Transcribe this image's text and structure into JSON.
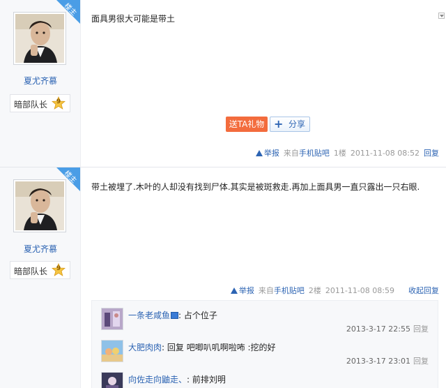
{
  "badge_label": "楼主",
  "posts": [
    {
      "author": "夏尤齐慕",
      "rank_name": "暗部队长",
      "rank_level": "9",
      "content": "面具男很大可能是带土",
      "gift_label": "送TA礼物",
      "share_label": "分享",
      "report_label": "举报",
      "source_prefix": "来自",
      "source_link": "手机贴吧",
      "floor": "1楼",
      "time": "2011-11-08 08:52",
      "reply_label": "回复"
    },
    {
      "author": "夏尤齐慕",
      "rank_name": "暗部队长",
      "rank_level": "9",
      "content": "带土被埋了.木叶的人却没有找到尸体.其实是被斑救走.再加上面具男一直只露出一只右眼.",
      "report_label": "举报",
      "source_prefix": "来自",
      "source_link": "手机贴吧",
      "floor": "2楼",
      "time": "2011-11-08 08:59",
      "fold_label": "收起回复",
      "sub_replies": [
        {
          "user": "一条老咸鱼",
          "text": ": 占个位子",
          "time": "2013-3-17 22:55",
          "reply_label": "回复"
        },
        {
          "user": "大肥肉肉",
          "text": ": 回复 吧唧叭叽啊啦咘 :挖的好",
          "time": "2013-3-17 23:01",
          "reply_label": "回复"
        },
        {
          "user": "向佐走向鼬走、",
          "text": ": 前排刘明",
          "time": "",
          "reply_label": ""
        }
      ]
    }
  ],
  "colors": {
    "link_blue": "#2d64b3",
    "gift_orange": "#f36c3d",
    "badge_blue": "#4a9de6",
    "sidebar_bg": "#f7f8fa"
  },
  "icons": [
    "post-menu-arrow-icon",
    "lz-badge-icon",
    "level-star-icon",
    "share-plus-icon",
    "report-warning-icon",
    "vip-icon"
  ]
}
